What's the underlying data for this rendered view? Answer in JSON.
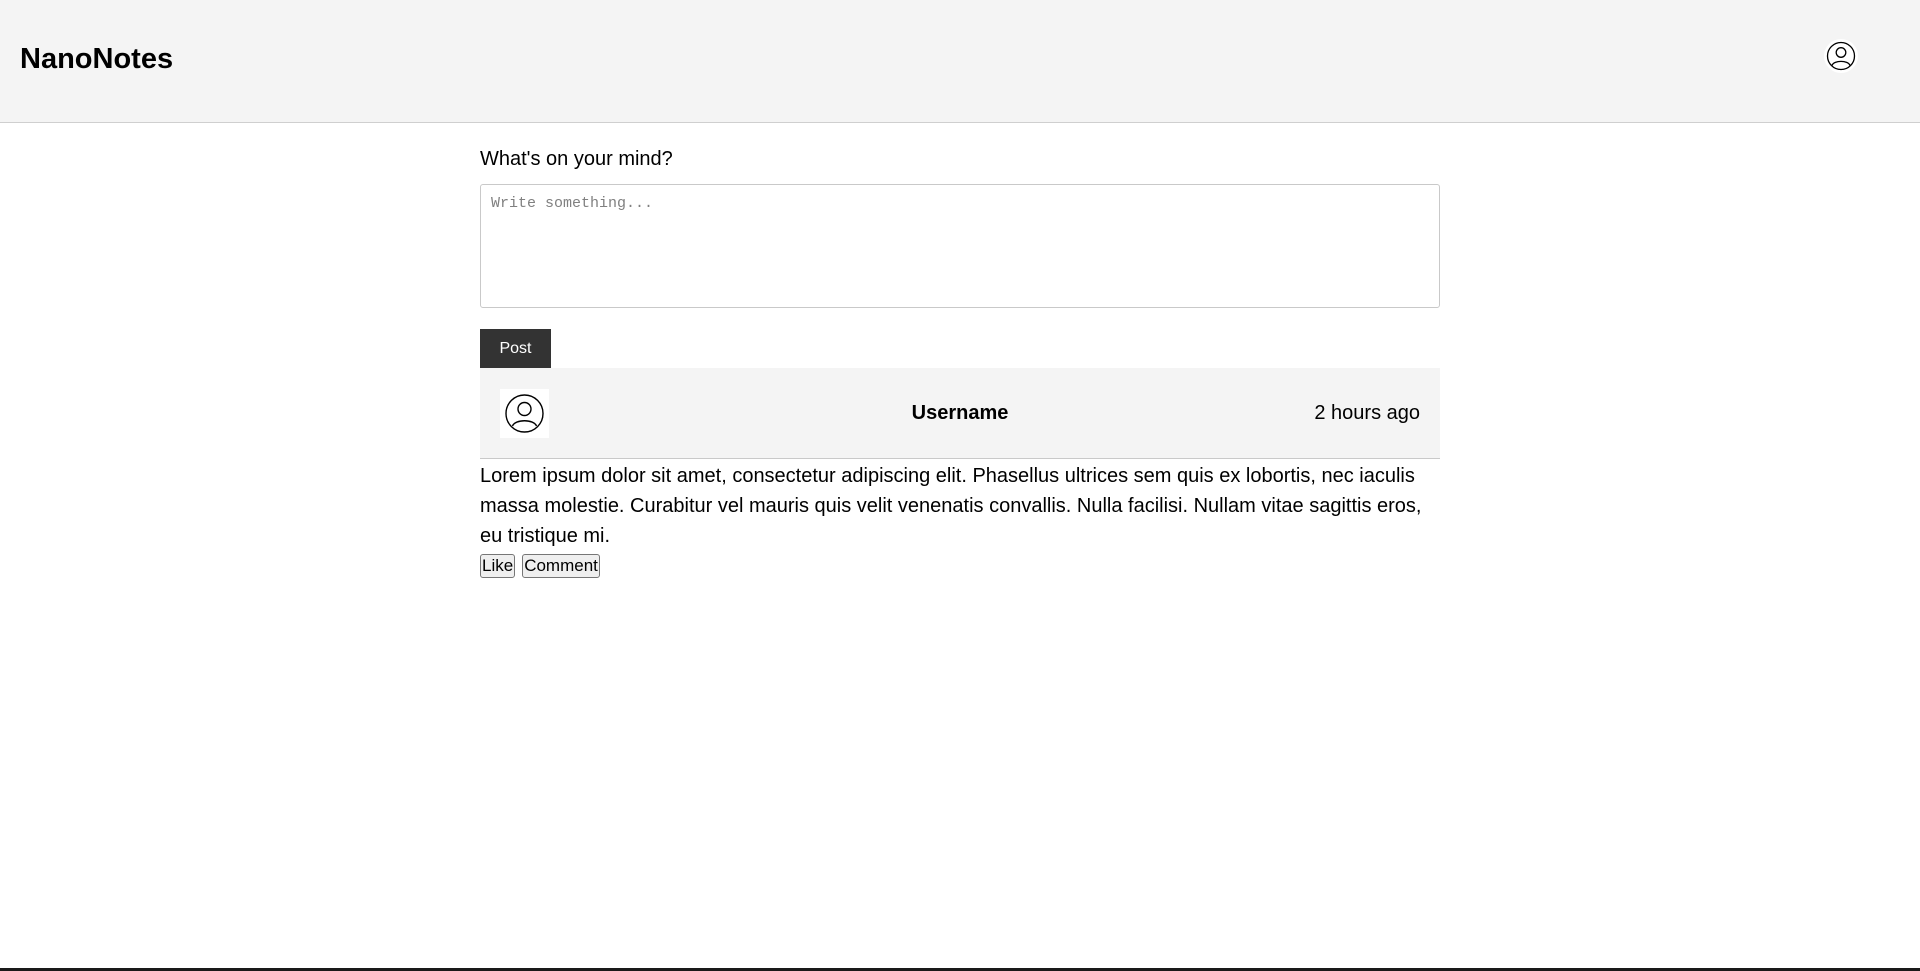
{
  "header": {
    "app_title": "NanoNotes",
    "profile_icon": "user-circle-icon"
  },
  "composer": {
    "label": "What's on your mind?",
    "placeholder": "Write something...",
    "value": "",
    "post_label": "Post"
  },
  "post": {
    "avatar_icon": "user-circle-icon",
    "username": "Username",
    "timestamp": "2 hours ago",
    "body": "Lorem ipsum dolor sit amet, consectetur adipiscing elit. Phasellus ultrices sem quis ex lobortis, nec iaculis massa molestie. Curabitur vel mauris quis velit venenatis convallis. Nulla facilisi. Nullam vitae sagittis eros, eu tristique mi.",
    "like_label": "Like",
    "comment_label": "Comment"
  }
}
